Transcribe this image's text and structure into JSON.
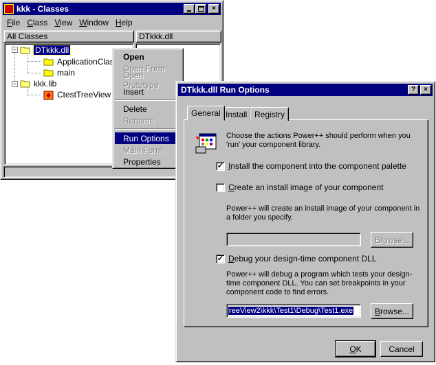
{
  "main_window": {
    "title": "kkk - Classes",
    "menu": [
      "File",
      "Class",
      "View",
      "Window",
      "Help"
    ],
    "left_header": "All Classes",
    "right_header": "DTkkk.dll",
    "tree": [
      {
        "label": "DTkkk.dll",
        "selected": true
      },
      {
        "label": "ApplicationClass"
      },
      {
        "label": "main"
      },
      {
        "label": "kkk.lib"
      },
      {
        "label": "CtestTreeView"
      }
    ]
  },
  "context_menu": {
    "items": [
      {
        "label": "Open"
      },
      {
        "label": "Open Form"
      },
      {
        "label": "Open Prototype"
      },
      {
        "label": "Insert"
      },
      {
        "label": "Delete"
      },
      {
        "label": "Rename"
      },
      {
        "label": "Run Options"
      },
      {
        "label": "Main Form"
      },
      {
        "label": "Properties"
      }
    ]
  },
  "dialog": {
    "title": "DTkkk.dll Run Options",
    "help_glyph": "?",
    "close_glyph": "×",
    "tabs": [
      "General",
      "Install",
      "Registry"
    ],
    "active_tab": "General",
    "intro": "Choose the actions Power++ should perform when you 'run' your component library.",
    "install_palette": {
      "label": "Install the component into the component palette",
      "checked": true
    },
    "install_image": {
      "label": "Create an install image of your component",
      "checked": false
    },
    "install_image_help": "Power++ will create an install image of your component in a folder you specify.",
    "install_image_path": "",
    "debug_dll": {
      "label": "Debug your design-time component DLL",
      "checked": true
    },
    "debug_help": "Power++ will debug a program which tests your design-time component DLL.  You can set breakpoints in your component code to find errors.",
    "debug_path": "reeView2\\kkk\\Test1\\Debug\\Test1.exe",
    "browse_label": "Browse...",
    "ok_label": "OK",
    "cancel_label": "Cancel",
    "check_glyph": "✓"
  }
}
